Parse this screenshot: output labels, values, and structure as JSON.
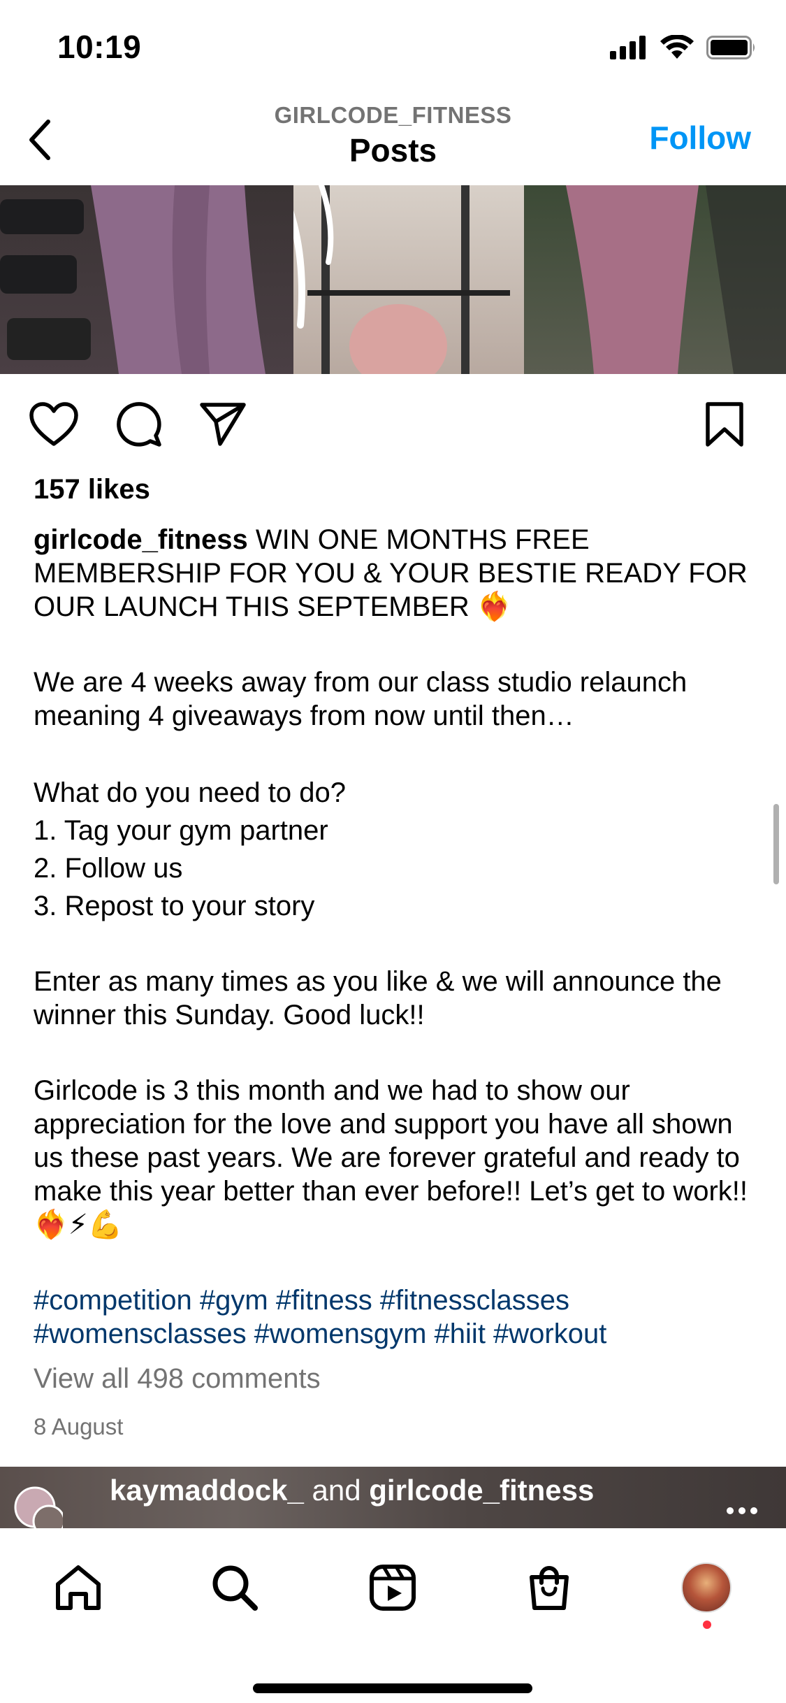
{
  "status_bar": {
    "time": "10:19",
    "icons": [
      "cellular-signal-icon",
      "wifi-icon",
      "battery-icon"
    ]
  },
  "header": {
    "account": "GIRLCODE_FITNESS",
    "title": "Posts",
    "follow_label": "Follow"
  },
  "post": {
    "likes": "157 likes",
    "caption_user": "girlcode_fitness",
    "caption_lines": [
      " WIN ONE MONTHS FREE MEMBERSHIP FOR YOU & YOUR BESTIE READY FOR OUR LAUNCH THIS SEPTEMBER ❤️‍🔥",
      "We are 4 weeks away from our class studio relaunch meaning 4 giveaways from now until then…",
      "What do you need to do?",
      "1. Tag your gym partner",
      "2. Follow us",
      "3. Repost to your story",
      "Enter as many times as you like & we will announce the winner this Sunday. Good luck!!",
      "Girlcode is 3 this month and we had to show our appreciation for the love and support you have all shown us these past years. We are forever grateful and ready to make this year better than ever before!! Let’s get to work!! ❤️‍🔥⚡💪",
      "#competition #gym #fitness #fitnessclasses #womensclasses #womensgym #hiit #workout"
    ],
    "view_comments": "View all 498 comments",
    "date": "8 August"
  },
  "next_post": {
    "user1": "kaymaddock_",
    "connector": " and ",
    "user2": "girlcode_fitness"
  },
  "tab_bar": {
    "items": [
      "home-icon",
      "search-icon",
      "reels-icon",
      "shop-icon",
      "profile-avatar"
    ]
  },
  "colors": {
    "accent": "#0095f6",
    "hashtag": "#00376b",
    "secondary_text": "#737373",
    "notification": "#ff3040"
  }
}
